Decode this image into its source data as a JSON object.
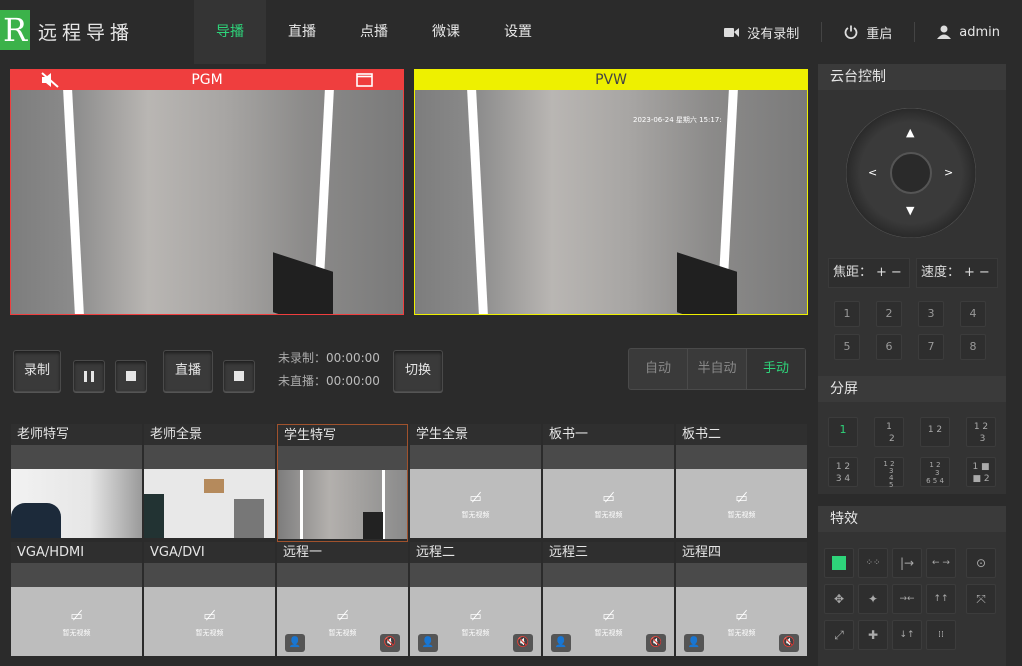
{
  "app": {
    "logo_letter": "R",
    "title": "远程导播"
  },
  "nav": [
    {
      "label": "导播",
      "active": true
    },
    {
      "label": "直播"
    },
    {
      "label": "点播"
    },
    {
      "label": "微课"
    },
    {
      "label": "设置"
    }
  ],
  "topright": {
    "record_status": "没有录制",
    "restart": "重启",
    "user": "admin"
  },
  "pgm": {
    "label": "PGM"
  },
  "pvw": {
    "label": "PVW",
    "timestamp": "2023-06-24 星期六 15:17:"
  },
  "controls": {
    "record": "录制",
    "live": "直播",
    "rec_status_label": "未录制：",
    "rec_status_time": "00:00:00",
    "live_status_label": "未直播：",
    "live_status_time": "00:00:00",
    "switch": "切换",
    "modes": [
      "自动",
      "半自动",
      "手动"
    ],
    "active_mode": "手动"
  },
  "sources": [
    {
      "title": "老师特写",
      "has_video": true
    },
    {
      "title": "老师全景",
      "has_video": true
    },
    {
      "title": "学生特写",
      "has_video": true,
      "selected": true
    },
    {
      "title": "学生全景",
      "has_video": false
    },
    {
      "title": "板书一",
      "has_video": false
    },
    {
      "title": "板书二",
      "has_video": false
    },
    {
      "title": "VGA/HDMI",
      "has_video": false
    },
    {
      "title": "VGA/DVI",
      "has_video": false
    },
    {
      "title": "远程一",
      "has_video": false,
      "remote": true
    },
    {
      "title": "远程二",
      "has_video": false,
      "remote": true
    },
    {
      "title": "远程三",
      "has_video": false,
      "remote": true
    },
    {
      "title": "远程四",
      "has_video": false,
      "remote": true
    }
  ],
  "no_video_text": "暂无视频",
  "ptz": {
    "title": "云台控制",
    "focus_label": "焦距：",
    "speed_label": "速度：",
    "presets": [
      "1",
      "2",
      "3",
      "4",
      "5",
      "6",
      "7",
      "8"
    ]
  },
  "split": {
    "title": "分屏",
    "active": "1"
  },
  "effects": {
    "title": "特效"
  },
  "colors": {
    "pgm": "#ef3e3e",
    "pvw": "#eef000",
    "accent": "#2ed47a",
    "logo": "#3bb24a"
  }
}
